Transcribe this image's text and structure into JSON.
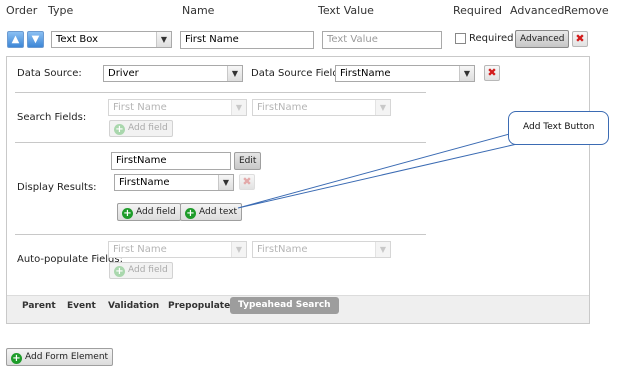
{
  "headers": {
    "order": "Order",
    "type": "Type",
    "name": "Name",
    "text_value": "Text Value",
    "required": "Required",
    "advanced": "Advanced",
    "remove": "Remove"
  },
  "row": {
    "type_value": "Text Box",
    "name_value": "First Name",
    "text_value_placeholder": "Text Value",
    "required_label": "Required",
    "advanced_label": "Advanced"
  },
  "data_source": {
    "label": "Data Source:",
    "value": "Driver",
    "field_label": "Data Source Field:",
    "field_value": "FirstName"
  },
  "search_fields": {
    "label": "Search Fields:",
    "select1": "First Name",
    "select2": "FirstName",
    "add_field": "Add field"
  },
  "display_results": {
    "label": "Display Results:",
    "text_value": "FirstName",
    "edit": "Edit",
    "select_value": "FirstName",
    "add_field": "Add field",
    "add_text": "Add text"
  },
  "auto_populate": {
    "label": "Auto-populate Fields:",
    "select1": "First Name",
    "select2": "FirstName",
    "add_field": "Add field"
  },
  "callout": {
    "text": "Add Text Button"
  },
  "tabs": [
    "Parent",
    "Event",
    "Validation",
    "Prepopulate",
    "Typeahead Search"
  ],
  "active_tab": "Typeahead Search",
  "add_form_element": "Add Form Element",
  "colors": {
    "accent_green": "#1e9c2a",
    "remove_red": "#d21a1a",
    "arrow_blue": "#3d86d6"
  }
}
